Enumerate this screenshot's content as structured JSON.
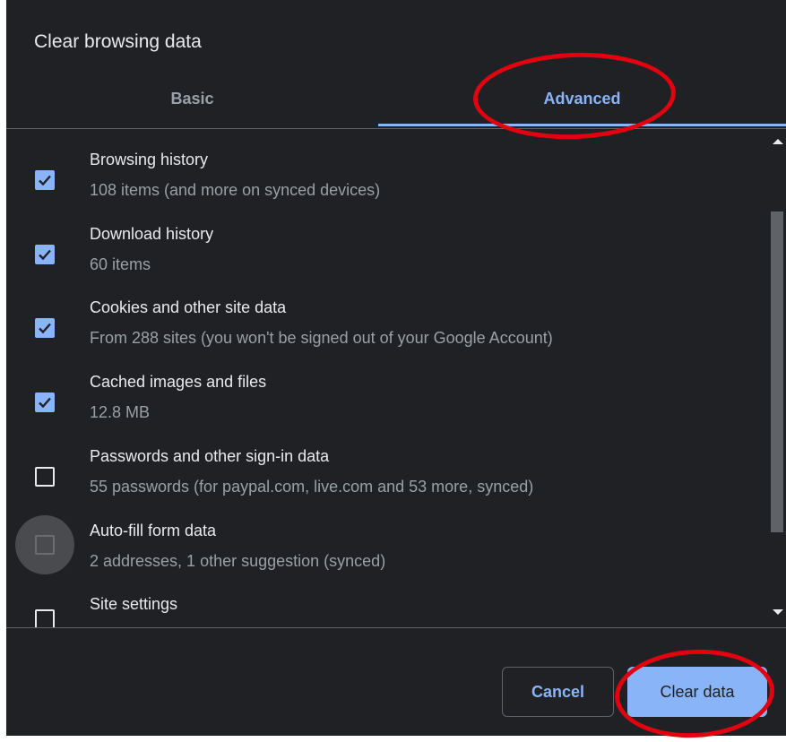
{
  "dialog": {
    "title": "Clear browsing data"
  },
  "tabs": [
    {
      "label": "Basic",
      "selected": false
    },
    {
      "label": "Advanced",
      "selected": true
    }
  ],
  "items": [
    {
      "title": "Browsing history",
      "subtitle": "108 items (and more on synced devices)",
      "checked": true
    },
    {
      "title": "Download history",
      "subtitle": "60 items",
      "checked": true
    },
    {
      "title": "Cookies and other site data",
      "subtitle": "From 288 sites (you won't be signed out of your Google Account)",
      "checked": true
    },
    {
      "title": "Cached images and files",
      "subtitle": "12.8 MB",
      "checked": true
    },
    {
      "title": "Passwords and other sign-in data",
      "subtitle": "55 passwords (for paypal.com, live.com and 53 more, synced)",
      "checked": false
    },
    {
      "title": "Auto-fill form data",
      "subtitle": "2 addresses, 1 other suggestion (synced)",
      "checked": false
    },
    {
      "title": "Site settings",
      "subtitle": "",
      "checked": false
    }
  ],
  "buttons": {
    "cancel_label": "Cancel",
    "clear_label": "Clear data"
  },
  "colors": {
    "background": "#202124",
    "accent": "#8ab4f8",
    "text_primary": "#e8eaed",
    "text_secondary": "#9aa0a6",
    "annotation": "#e3000f"
  }
}
